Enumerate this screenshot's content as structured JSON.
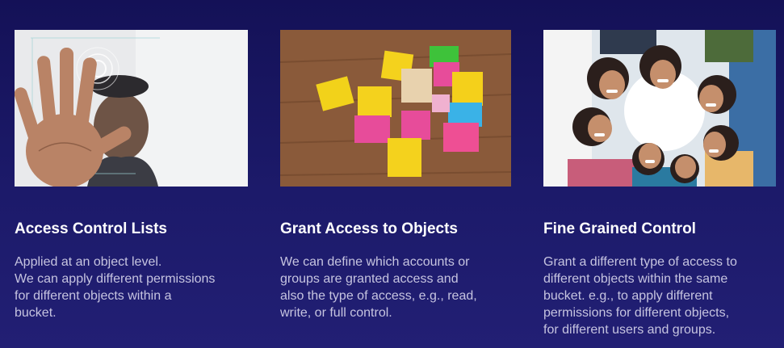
{
  "cards": [
    {
      "title": "Access Control Lists",
      "image_subject": "hand-fingerprint-scan",
      "desc_lines": [
        "Applied at an object level.",
        "We can apply different permissions",
        "for different objects within a",
        "bucket."
      ]
    },
    {
      "title": "Grant Access to Objects",
      "image_subject": "colored-wooden-blocks",
      "desc_lines": [
        "We can define which accounts or",
        "groups are granted access and",
        "also the type of access, e.g., read,",
        "write, or full control."
      ]
    },
    {
      "title": "Fine Grained Control",
      "image_subject": "group-of-people-circle",
      "desc_lines": [
        "Grant a different type of access to",
        "different objects within the same",
        "bucket. e.g., to apply different",
        "permissions for different objects,",
        "for different users and groups."
      ]
    }
  ],
  "colors": {
    "background": "#1a176a",
    "title": "#ffffff",
    "text": "#c6c4e0"
  }
}
